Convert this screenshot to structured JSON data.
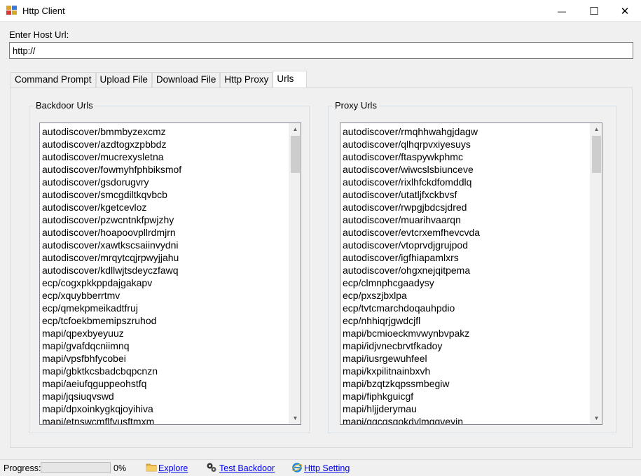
{
  "window": {
    "title": "Http Client",
    "minimize": "—",
    "maximize": "☐",
    "close": "✕"
  },
  "host": {
    "label": "Enter Host Url:",
    "value": "http://"
  },
  "tabs": [
    {
      "label": "Command Prompt"
    },
    {
      "label": "Upload File"
    },
    {
      "label": "Download File"
    },
    {
      "label": "Http Proxy"
    },
    {
      "label": "Urls"
    }
  ],
  "backdoor": {
    "label": "Backdoor Urls",
    "items": [
      "autodiscover/bmmbyzexcmz",
      "autodiscover/azdtogxzpbbdz",
      "autodiscover/mucrexysletna",
      "autodiscover/fowmyhfphbiksmof",
      "autodiscover/gsdorugvry",
      "autodiscover/smcgdiltkqvbcb",
      "autodiscover/kgetcevloz",
      "autodiscover/pzwcntnkfpwjzhy",
      "autodiscover/hoapoovpllrdmjrn",
      "autodiscover/xawtkscsaiinvydni",
      "autodiscover/mrqytcqjrpwyjjahu",
      "autodiscover/kdllwjtsdeyczfawq",
      "ecp/cogxpkkppdajgakapv",
      "ecp/xquybberrtmv",
      "ecp/qmekpmeikadtfruj",
      "ecp/tcfoekbmemipszruhod",
      "mapi/qpexbyeyuuz",
      "mapi/gvafdqcniimnq",
      "mapi/vpsfbhfycobei",
      "mapi/gbktkcsbadcbqpcnzn",
      "mapi/aeiufqguppeohstfq",
      "mapi/jqsiuqvswd",
      "mapi/dpxoinkygkqjoyihiva",
      "mapi/etnswcmflfvusftmxm"
    ]
  },
  "proxy": {
    "label": "Proxy Urls",
    "items": [
      "autodiscover/rmqhhwahgjdagw",
      "autodiscover/qlhqrpvxiyesuys",
      "autodiscover/ftaspywkphmc",
      "autodiscover/wiwcslsbiunceve",
      "autodiscover/rixlhfckdfomddlq",
      "autodiscover/utatljfxckbvsf",
      "autodiscover/rwpgjbdcsjdred",
      "autodiscover/muarihvaarqn",
      "autodiscover/evtcrxemfhevcvda",
      "autodiscover/vtoprvdjgrujpod",
      "autodiscover/igfhiapamlxrs",
      "autodiscover/ohgxnejqitpema",
      "ecp/clmnphcgaadysy",
      "ecp/pxszjbxlpa",
      "ecp/tvtcmarchdoqauhpdio",
      "ecp/nhhiqrjgwdcjfl",
      "mapi/bcmioeckmvwynbvpakz",
      "mapi/idjvnecbrvtfkadoy",
      "mapi/iusrgewuhfeel",
      "mapi/kxpilitnainbxvh",
      "mapi/bzqtzkqpssmbegiw",
      "mapi/fiphkguicgf",
      "mapi/hljjderymau",
      "mapi/ggcgsgokdvlmggvevin"
    ]
  },
  "status": {
    "progress_label": "Progress:",
    "progress_value": 0,
    "progress_text": "0%",
    "explore": "Explore",
    "test_backdoor": "Test Backdoor",
    "http_setting": "Http Setting"
  },
  "colors": {
    "link": "#0000ee",
    "folder": "#e8b64a",
    "ie": "#1f88d4"
  },
  "icons": {
    "app": "app-icon",
    "explore": "folder-icon",
    "test_backdoor": "gears-icon",
    "http_setting": "internet-explorer-icon"
  }
}
